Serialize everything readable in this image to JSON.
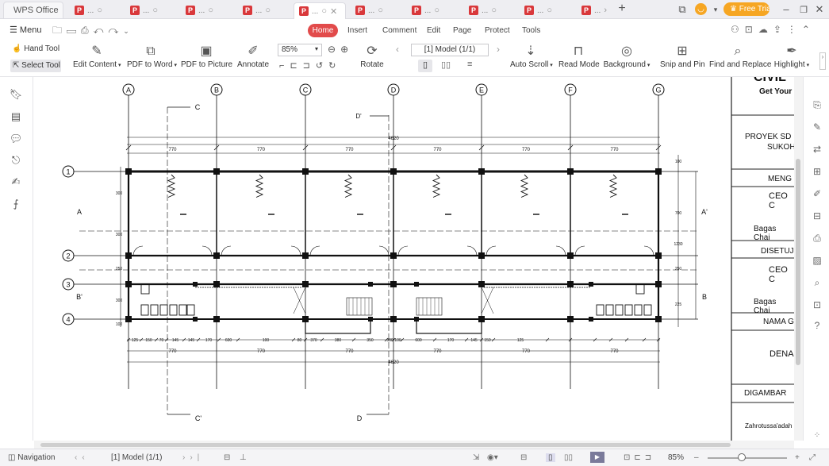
{
  "app": {
    "name": "WPS Office",
    "trial_label": "Free Trial"
  },
  "tabs": [
    {
      "label": "..."
    },
    {
      "label": "..."
    },
    {
      "label": "..."
    },
    {
      "label": "..."
    },
    {
      "label": "...",
      "active": true
    },
    {
      "label": "..."
    },
    {
      "label": "..."
    },
    {
      "label": "..."
    },
    {
      "label": "..."
    },
    {
      "label": "..."
    }
  ],
  "menubar": {
    "menu_label": "Menu",
    "ribbon_tabs": [
      "Home",
      "Insert",
      "Comment",
      "Edit",
      "Page",
      "Protect",
      "Tools"
    ],
    "active_tab": "Home"
  },
  "toolbar": {
    "hand_tool": "Hand Tool",
    "select_tool": "Select Tool",
    "edit_content": "Edit Content",
    "pdf_to_word": "PDF to Word",
    "pdf_to_picture": "PDF to Picture",
    "annotate": "Annotate",
    "zoom": "85%",
    "page_selector": "[1] Model (1/1)",
    "rotate": "Rotate",
    "auto_scroll": "Auto Scroll",
    "read_mode": "Read Mode",
    "background": "Background",
    "snip_and_pin": "Snip and Pin",
    "find_and_replace": "Find and Replace",
    "highlight": "Highlight"
  },
  "drawing": {
    "grid_letters": [
      "A",
      "B",
      "C",
      "D",
      "E",
      "F",
      "G"
    ],
    "grid_numbers": [
      "1",
      "2",
      "3",
      "4"
    ],
    "section_marks": [
      "C",
      "C'",
      "D",
      "D'",
      "A",
      "A'",
      "B",
      "B'"
    ],
    "spacing_label": "770",
    "total_label": "4620",
    "dims_left": [
      "300",
      "300",
      "250",
      "300",
      "100"
    ],
    "dims_right": [
      "100",
      "700",
      "1230",
      "250",
      "225"
    ],
    "bottom_dims": [
      "125",
      "150",
      "70",
      "145",
      "145",
      "170",
      "600",
      "100",
      "80",
      "370",
      "380",
      "350",
      "380",
      "100",
      "600",
      "170",
      "145",
      "150",
      "125"
    ]
  },
  "title_block": {
    "company": "CIVIL",
    "tagline": "Get Your",
    "project": [
      "PROYEK SD",
      "SUKOH"
    ],
    "row_meng": "MENG",
    "ceo1": "CEO C",
    "name1": "Bagas Chai",
    "disetuju": "DISETUJ",
    "ceo2": "CEO C",
    "name2": "Bagas Chai",
    "nama": "NAMA G",
    "denah": "DENA",
    "digambar": "DIGAMBAR",
    "drafter": "Zahrotussa'adah"
  },
  "statusbar": {
    "navigation": "Navigation",
    "page": "[1] Model (1/1)",
    "zoom": "85%"
  }
}
